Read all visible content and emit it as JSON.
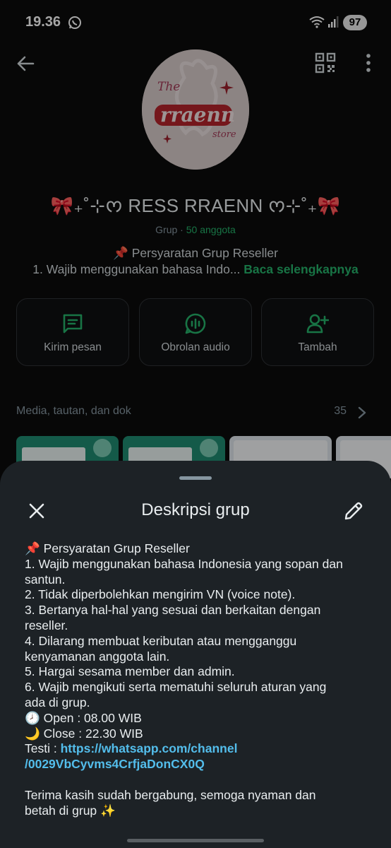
{
  "status_bar": {
    "time": "19.36",
    "battery": "97"
  },
  "group": {
    "name": "🎀₊˚⊹ᰔ RESS RRAENN ᰔ⊹˚₊🎀",
    "type": "Grup",
    "separator": " · ",
    "members": "50 anggota",
    "avatar_text": {
      "top": "The",
      "main": "rraenn",
      "sub": "store"
    },
    "desc_preview_line1": "📌 Persyaratan Grup Reseller",
    "desc_preview_line2": "1. Wajib menggunakan bahasa Indo... ",
    "read_more": "Baca selengkapnya"
  },
  "actions": [
    {
      "label": "Kirim pesan",
      "icon": "message-icon"
    },
    {
      "label": "Obrolan audio",
      "icon": "audio-chat-icon"
    },
    {
      "label": "Tambah",
      "icon": "add-person-icon"
    }
  ],
  "media": {
    "title": "Media, tautan, dan dok",
    "count": "35"
  },
  "sheet": {
    "title": "Deskripsi grup",
    "lines": [
      "📌 Persyaratan Grup Reseller",
      "1. Wajib menggunakan bahasa Indonesia yang sopan dan",
      "santun.",
      "2. Tidak diperbolehkan mengirim VN (voice note).",
      "3. Bertanya hal-hal yang sesuai dan berkaitan dengan",
      "reseller.",
      "4. Dilarang membuat keributan atau mengganggu",
      "kenyamanan anggota lain.",
      "5. Hargai sesama member dan admin.",
      "6. Wajib mengikuti serta mematuhi seluruh aturan yang",
      "ada di grup.",
      "🕗 Open : 08.00 WIB",
      "🌙 Close : 22.30 WIB"
    ],
    "testi_label": "Testi : ",
    "link_line1": "https://whatsapp.com/channel",
    "link_line2": "/0029VbCyvms4CrfjaDonCX0Q",
    "closing_line1": "Terima kasih sudah bergabung, semoga nyaman dan",
    "closing_line2": "betah di grup ✨"
  },
  "colors": {
    "accent_green": "#25b36b",
    "link_blue": "#53bdeb",
    "sheet_bg": "#1d2226"
  }
}
